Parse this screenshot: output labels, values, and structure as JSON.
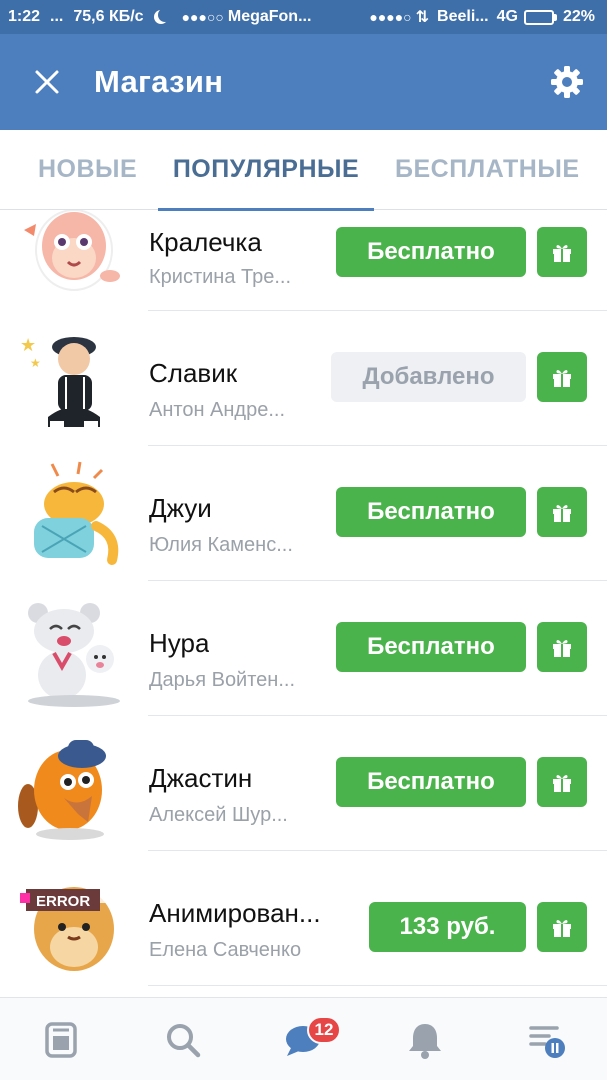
{
  "status_bar": {
    "time": "1:22",
    "dots": "...",
    "speed": "75,6 КБ/с",
    "carrier1_signal": "●●●○○",
    "carrier1": "MegaFon...",
    "carrier2_signal": "●●●●○",
    "carrier2": "Beeli...",
    "network": "4G",
    "battery_level": 0.22,
    "battery_text": "22%"
  },
  "header": {
    "title": "Магазин",
    "close_icon": "close-icon",
    "settings_icon": "gear-icon"
  },
  "tabs": [
    {
      "label": "НОВЫЕ",
      "active": false
    },
    {
      "label": "ПОПУЛЯРНЫЕ",
      "active": true
    },
    {
      "label": "БЕСПЛАТНЫЕ",
      "active": false
    }
  ],
  "packs": [
    {
      "name": "Кралечка",
      "author": "Кристина Тре...",
      "action": "Бесплатно",
      "state": "free"
    },
    {
      "name": "Славик",
      "author": "Антон Андре...",
      "action": "Добавлено",
      "state": "added"
    },
    {
      "name": "Джуи",
      "author": "Юлия Каменс...",
      "action": "Бесплатно",
      "state": "free"
    },
    {
      "name": "Нура",
      "author": "Дарья Войтен...",
      "action": "Бесплатно",
      "state": "free"
    },
    {
      "name": "Джастин",
      "author": "Алексей Шур...",
      "action": "Бесплатно",
      "state": "free"
    },
    {
      "name": "Анимирован...",
      "author": "Елена Савченко",
      "action": "133 руб.",
      "state": "paid"
    }
  ],
  "sticker_labels": {
    "error": "ERROR"
  },
  "bottom_nav": {
    "items": [
      "news-icon",
      "search-icon",
      "messages-icon",
      "bell-icon",
      "menu-icon"
    ],
    "messages_badge": "12"
  },
  "colors": {
    "header": "#4d7ebd",
    "statusbar": "#3f6fa8",
    "green": "#4bb34b",
    "active_tab": "#4a6d94",
    "inactive_tab": "#a6b6c7"
  }
}
